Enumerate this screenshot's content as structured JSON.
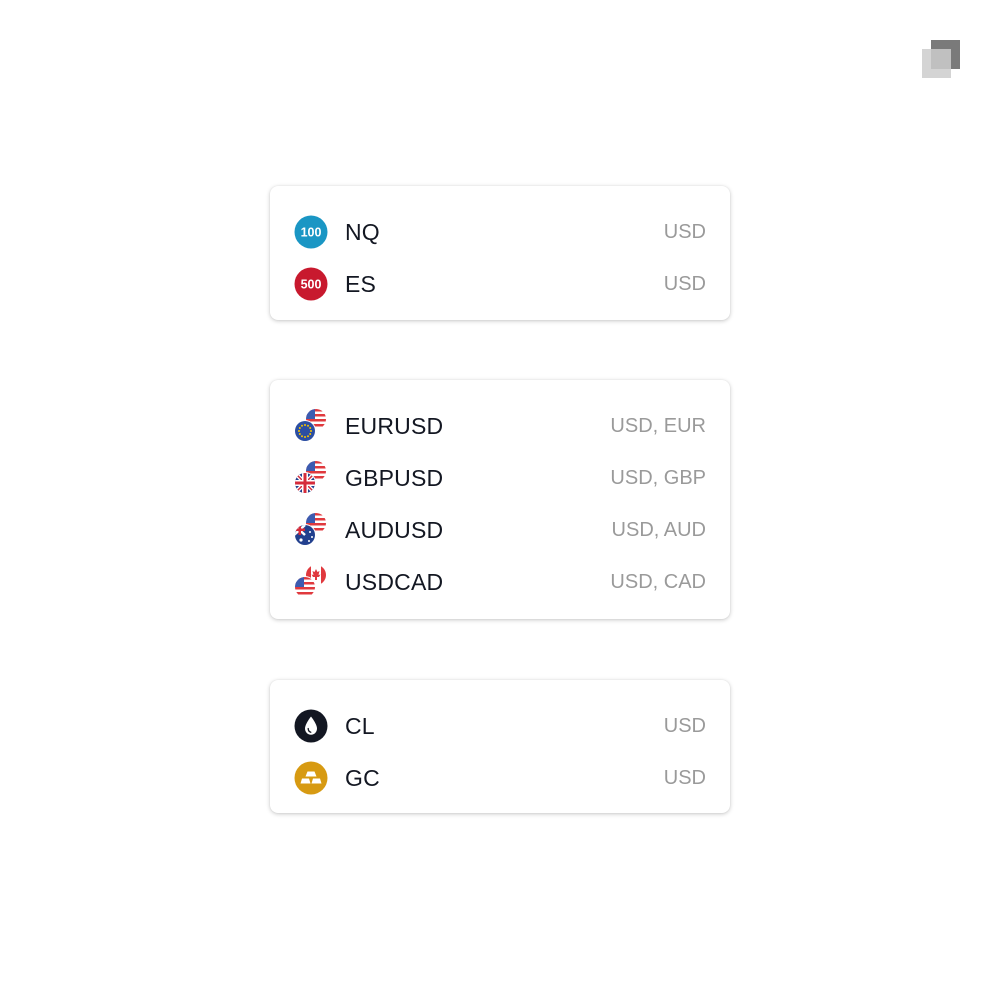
{
  "groups": [
    {
      "items": [
        {
          "symbol": "NQ",
          "currency": "USD",
          "icon": "nasdaq-100-icon",
          "badge": "100",
          "color": "#1a96c4"
        },
        {
          "symbol": "ES",
          "currency": "USD",
          "icon": "sp-500-icon",
          "badge": "500",
          "color": "#c8192e"
        }
      ]
    },
    {
      "items": [
        {
          "symbol": "EURUSD",
          "currency": "USD, EUR",
          "icon": "eu-us-flags-icon"
        },
        {
          "symbol": "GBPUSD",
          "currency": "USD, GBP",
          "icon": "uk-us-flags-icon"
        },
        {
          "symbol": "AUDUSD",
          "currency": "USD, AUD",
          "icon": "au-us-flags-icon"
        },
        {
          "symbol": "USDCAD",
          "currency": "USD, CAD",
          "icon": "us-ca-flags-icon"
        }
      ]
    },
    {
      "items": [
        {
          "symbol": "CL",
          "currency": "USD",
          "icon": "crude-oil-drop-icon",
          "color": "#131722"
        },
        {
          "symbol": "GC",
          "currency": "USD",
          "icon": "gold-bars-icon",
          "color": "#d79a12"
        }
      ]
    }
  ]
}
